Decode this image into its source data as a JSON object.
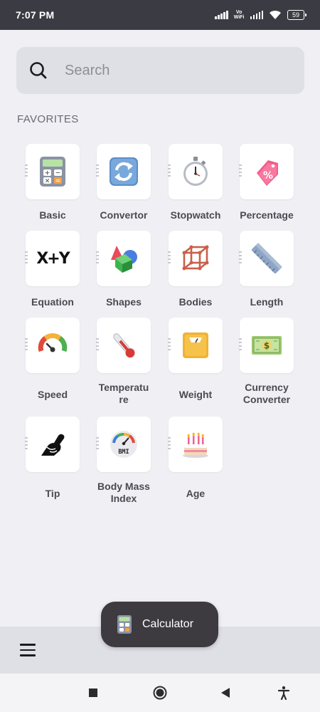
{
  "status_bar": {
    "time": "7:07 PM",
    "vowifi": [
      "Vo",
      "WiFi"
    ],
    "battery": "59"
  },
  "search": {
    "placeholder": "Search"
  },
  "favorites": {
    "title": "FAVORITES",
    "items": [
      {
        "label": "Basic",
        "icon": "calculator-icon"
      },
      {
        "label": "Convertor",
        "icon": "refresh-arrows-icon"
      },
      {
        "label": "Stopwatch",
        "icon": "stopwatch-icon"
      },
      {
        "label": "Percentage",
        "icon": "percent-tag-icon"
      },
      {
        "label": "Equation",
        "icon": "x-plus-y-icon"
      },
      {
        "label": "Shapes",
        "icon": "shapes-icon"
      },
      {
        "label": "Bodies",
        "icon": "cube-icon"
      },
      {
        "label": "Length",
        "icon": "ruler-icon"
      },
      {
        "label": "Speed",
        "icon": "speedometer-icon"
      },
      {
        "label": "Temperature",
        "icon": "thermometer-icon"
      },
      {
        "label": "Weight",
        "icon": "scale-icon"
      },
      {
        "label": "Currency Converter",
        "icon": "banknote-icon"
      },
      {
        "label": "Tip",
        "icon": "tip-hand-icon"
      },
      {
        "label": "Body Mass Index",
        "icon": "bmi-gauge-icon"
      },
      {
        "label": "Age",
        "icon": "birthday-cake-icon"
      }
    ],
    "labels_display": {
      "temperature": [
        "Temperatu",
        "re"
      ],
      "currency": [
        "Currency",
        "Converter"
      ],
      "bmi": [
        "Body Mass",
        "Index"
      ]
    },
    "bmi_text": "BMI",
    "equation_text": "X+Y",
    "currency_symbol": "$"
  },
  "toast": {
    "label": "Calculator"
  }
}
